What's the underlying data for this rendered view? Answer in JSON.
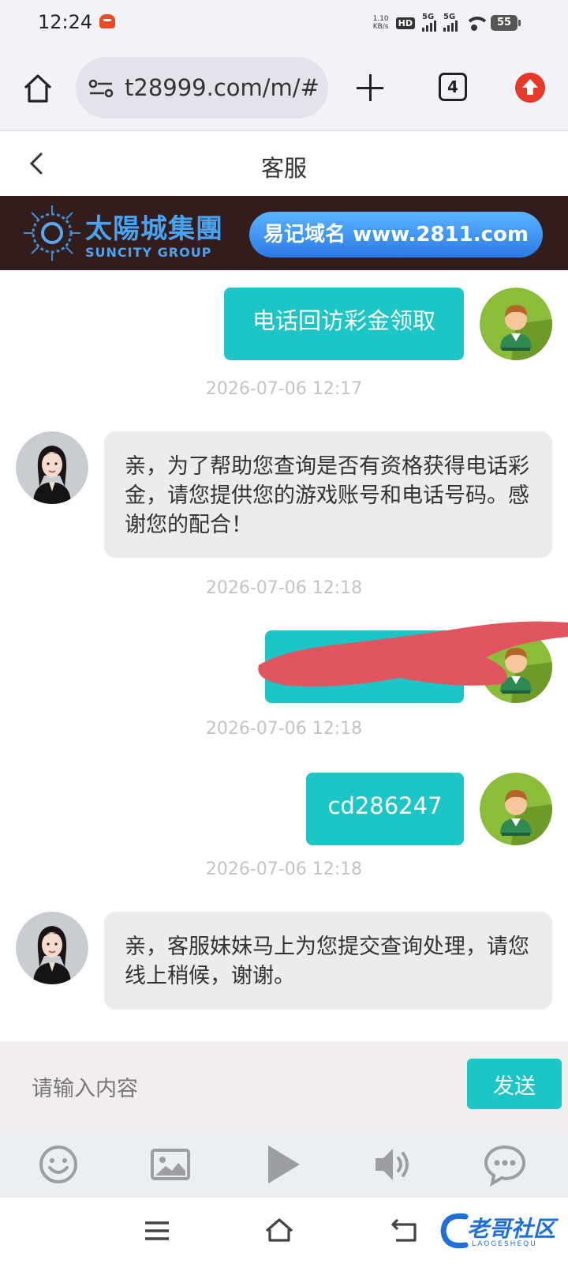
{
  "status_bar": {
    "time": "12:24",
    "net_speed_value": "1.10",
    "net_speed_unit": "KB/s",
    "hd_label": "HD",
    "signal1_label": "5G",
    "signal2_label": "5G",
    "battery": "55"
  },
  "browser": {
    "url": "t28999.com/m/#/",
    "tab_count": "4"
  },
  "header": {
    "title": "客服"
  },
  "banner": {
    "brand_cn": "太陽城集團",
    "brand_en": "SUNCITY GROUP",
    "domain_text": "易记域名 www.2811.com"
  },
  "chat": {
    "messages": [
      {
        "side": "out",
        "text": "电话回访彩金领取"
      },
      {
        "timestamp": "2026-07-06 12:17"
      },
      {
        "side": "in",
        "text": "亲，为了帮助您查询是否有资格获得电话彩金，请您提供您的游戏账号和电话号码。感谢您的配合！"
      },
      {
        "timestamp": "2026-07-06 12:18"
      },
      {
        "side": "out",
        "text": ""
      },
      {
        "timestamp": "2026-07-06 12:18"
      },
      {
        "side": "out",
        "text": "cd286247"
      },
      {
        "timestamp": "2026-07-06 12:18"
      },
      {
        "side": "in",
        "text": "亲，客服妹妹马上为您提交查询处理，请您线上稍候，谢谢。"
      }
    ]
  },
  "input": {
    "placeholder": "请输入内容",
    "send_label": "发送"
  },
  "watermark": {
    "text": "老哥社区",
    "sub": "LAOGESHEQU"
  },
  "colors": {
    "accent": "#1cc6c6",
    "bubble_in": "#eaeced",
    "banner_bg": "#331c1c",
    "banner_pill": "#2c79e6",
    "upgrade_red": "#e53a2a",
    "redaction": "#e05560"
  },
  "icons": {
    "toolbar": [
      "emoji-icon",
      "image-icon",
      "play-icon",
      "volume-icon",
      "chat-bubble-icon"
    ],
    "nav": [
      "menu-icon",
      "home-icon",
      "back-icon"
    ]
  }
}
